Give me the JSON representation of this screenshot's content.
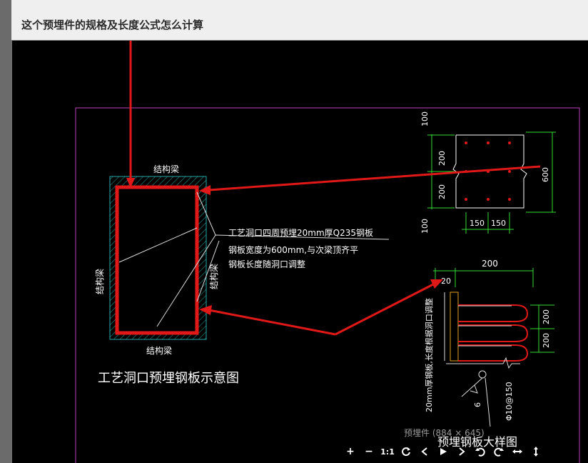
{
  "question": {
    "title": "这个预埋件的规格及长度公式怎么计算"
  },
  "cad": {
    "beam_top": "结构梁",
    "beam_bottom": "结构梁",
    "beam_left": "结构梁",
    "beam_right": "结构梁",
    "note_line1": "工艺洞口四周预埋20mm厚Q235钢板",
    "note_line2": "钢板宽度为600mm,与次梁顶齐平",
    "note_line3": "钢板长度随洞口调整",
    "diagram_title": "工艺洞口预埋钢板示意图",
    "dim_100_top": "100",
    "dim_200_a": "200",
    "dim_200_b": "200",
    "dim_100_bottom": "100",
    "dim_600": "600",
    "dim_150_a": "150",
    "dim_150_b": "150",
    "dim_200_detail": "200",
    "dim_20": "20",
    "dim_200_c": "200",
    "dim_200_d": "200",
    "detail_vertical_note": "20mm厚钢板,长度根据洞口调整",
    "rebar_label": "Φ10@150",
    "weld_label": "6",
    "detail_title": "预埋钢板大样图"
  },
  "image_caption": "预埋件 (884 × 645)",
  "toolbar": {
    "zoom_in": "+",
    "zoom_out": "−",
    "actual_size": "1:1"
  }
}
